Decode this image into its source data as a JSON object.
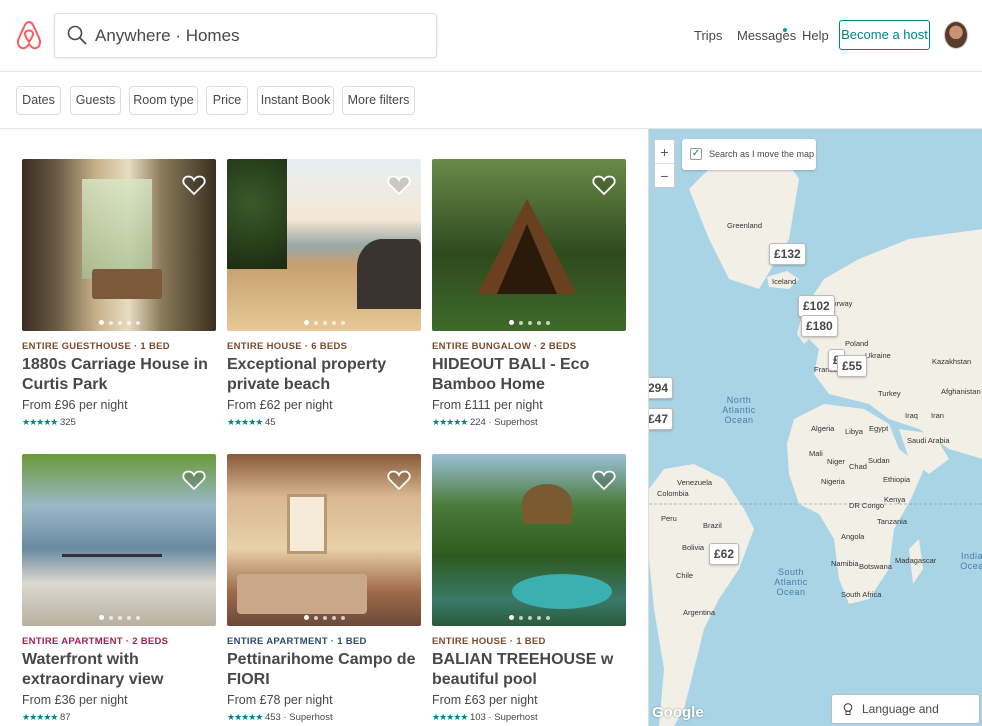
{
  "header": {
    "search_text": "Anywhere · Homes",
    "nav": {
      "trips": "Trips",
      "messages": "Messages",
      "help": "Help"
    },
    "host_button": "Become a host"
  },
  "filters": [
    "Dates",
    "Guests",
    "Room type",
    "Price",
    "Instant Book",
    "More filters"
  ],
  "listings": [
    {
      "type": "ENTIRE GUESTHOUSE · 1 BED",
      "title": "1880s Carriage House in Curtis Park",
      "price": "From £96  per night",
      "stars": "★★★★★",
      "reviews": "325"
    },
    {
      "type": "ENTIRE HOUSE · 6 BEDS",
      "title": "Exceptional property private beach",
      "price": "From £62  per night",
      "stars": "★★★★★",
      "reviews": "45"
    },
    {
      "type": "ENTIRE BUNGALOW · 2 BEDS",
      "title": "HIDEOUT BALI - Eco Bamboo Home",
      "price": "From £111  per night",
      "stars": "★★★★★",
      "reviews": "224 · Superhost"
    },
    {
      "type": "ENTIRE APARTMENT · 2 BEDS",
      "title": "Waterfront with extraordinary view",
      "price": "From £36  per night",
      "stars": "★★★★★",
      "reviews": "87"
    },
    {
      "type": "ENTIRE APARTMENT · 1 BED",
      "title": "Pettinarihome Campo de FIORI",
      "price": "From £78  per night",
      "stars": "★★★★★",
      "reviews": "453 · Superhost"
    },
    {
      "type": "ENTIRE HOUSE · 1 BED",
      "title": "BALIAN TREEHOUSE w beautiful pool",
      "price": "From £63  per night",
      "stars": "★★★★★",
      "reviews": "103 · Superhost"
    }
  ],
  "map": {
    "search_as_move": "Search as I move the map",
    "zoom_in": "+",
    "zoom_out": "−",
    "pins": [
      "£132",
      "£102",
      "£180",
      "£55",
      "£",
      "294",
      "£47",
      "£62"
    ],
    "labels": [
      "Greenland",
      "Iceland",
      "Norway",
      "Poland",
      "Ukraine",
      "Kazakhstan",
      "France",
      "Turkey",
      "Algeria",
      "Libya",
      "Egypt",
      "Saudi Arabia",
      "Mali",
      "Niger",
      "Chad",
      "Sudan",
      "Nigeria",
      "Ethiopia",
      "DR Congo",
      "Kenya",
      "Tanzania",
      "Angola",
      "Namibia",
      "Botswana",
      "South Africa",
      "Madagascar",
      "Venezuela",
      "Colombia",
      "Peru",
      "Brazil",
      "Bolivia",
      "Chile",
      "Argentina",
      "Iraq",
      "Iran",
      "Afghanistan"
    ],
    "oceans": [
      "North Atlantic Ocean",
      "South Atlantic Ocean",
      "India Ocea"
    ],
    "language_button": "Language and currency",
    "google": "Google"
  },
  "colors": {
    "brand": "#ff5a5f",
    "teal": "#008489"
  }
}
